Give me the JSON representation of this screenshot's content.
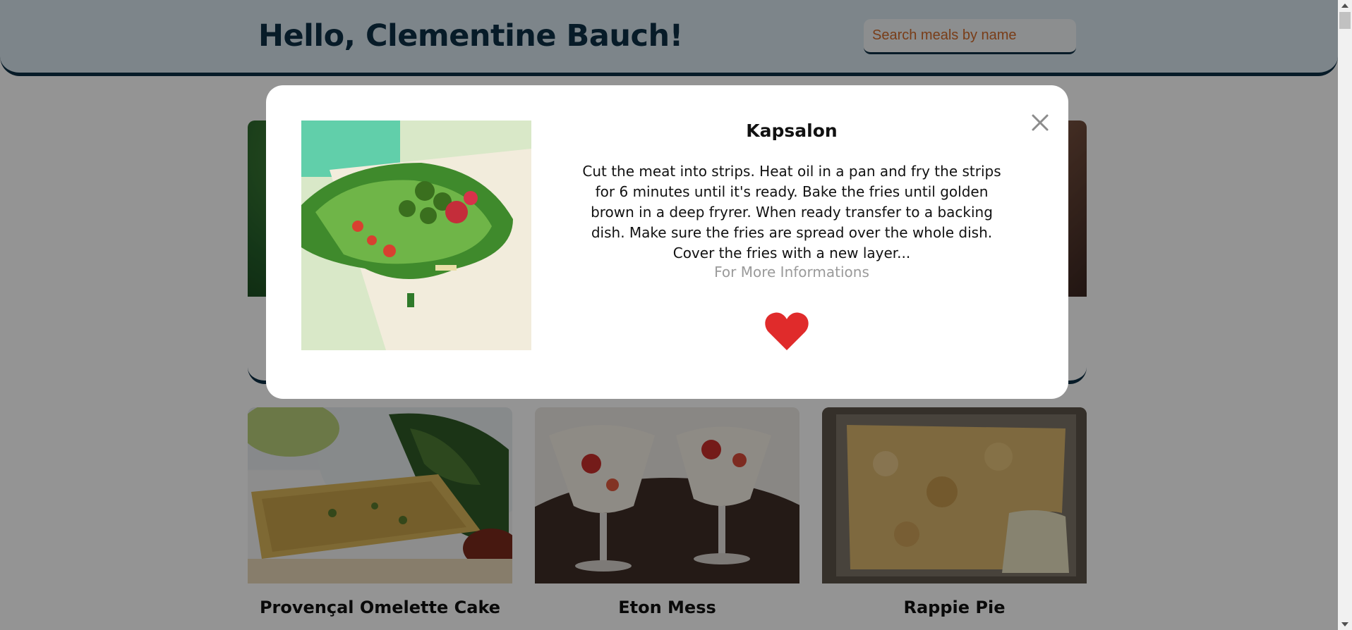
{
  "header": {
    "greeting": "Hello, Clementine Bauch!",
    "search_placeholder": "Search meals by name"
  },
  "cards": [
    {
      "title": "Provençal Omelette Cake"
    },
    {
      "title": "Eton Mess"
    },
    {
      "title": "Rappie Pie"
    }
  ],
  "modal": {
    "title": "Kapsalon",
    "description": "Cut the meat into strips. Heat oil in a pan and fry the strips for 6 minutes until it's ready. Bake the fries until golden brown in a deep fryrer. When ready transfer to a backing dish. Make sure the fries are spread over the whole dish. Cover the fries with a new layer...",
    "more_link": "For More Informations",
    "heart_color": "#e02b2b",
    "close_icon": "close-icon",
    "favorite_icon": "heart-icon"
  },
  "colors": {
    "header_bg": "#d7e6ee",
    "brand_dark": "#0d2f45",
    "placeholder": "#d06a2a"
  }
}
